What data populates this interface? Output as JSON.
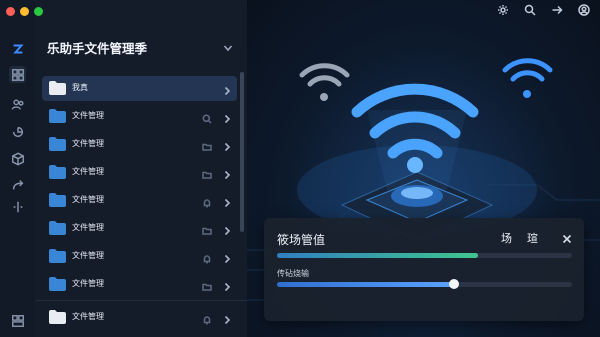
{
  "window": {
    "title": "乐助手文件管理季"
  },
  "rail": {
    "items": [
      "app-logo",
      "grid",
      "users",
      "share",
      "box",
      "redo",
      "split",
      "layout"
    ]
  },
  "files": {
    "header": "乐助手文件管理季",
    "rows": [
      {
        "label": "我真",
        "selected": true
      },
      {
        "label": "文件管理"
      },
      {
        "label": "文件管理"
      },
      {
        "label": "文件管理"
      },
      {
        "label": "文件管理"
      },
      {
        "label": "文件管理"
      },
      {
        "label": "文件管理"
      },
      {
        "label": "文件管理"
      },
      {
        "label": "文件管理"
      }
    ]
  },
  "topbar": {
    "icons": [
      "gear-icon",
      "search-icon",
      "arrow-right-icon",
      "user-icon"
    ]
  },
  "popup": {
    "title": "筱场管值",
    "action": "场 瑄",
    "subtitle": "传砧烧输",
    "progress1": 0.68,
    "progress2": 0.6
  },
  "colors": {
    "accent": "#3fc68f",
    "blue": "#4a8fff",
    "bg": "#0b1220"
  }
}
